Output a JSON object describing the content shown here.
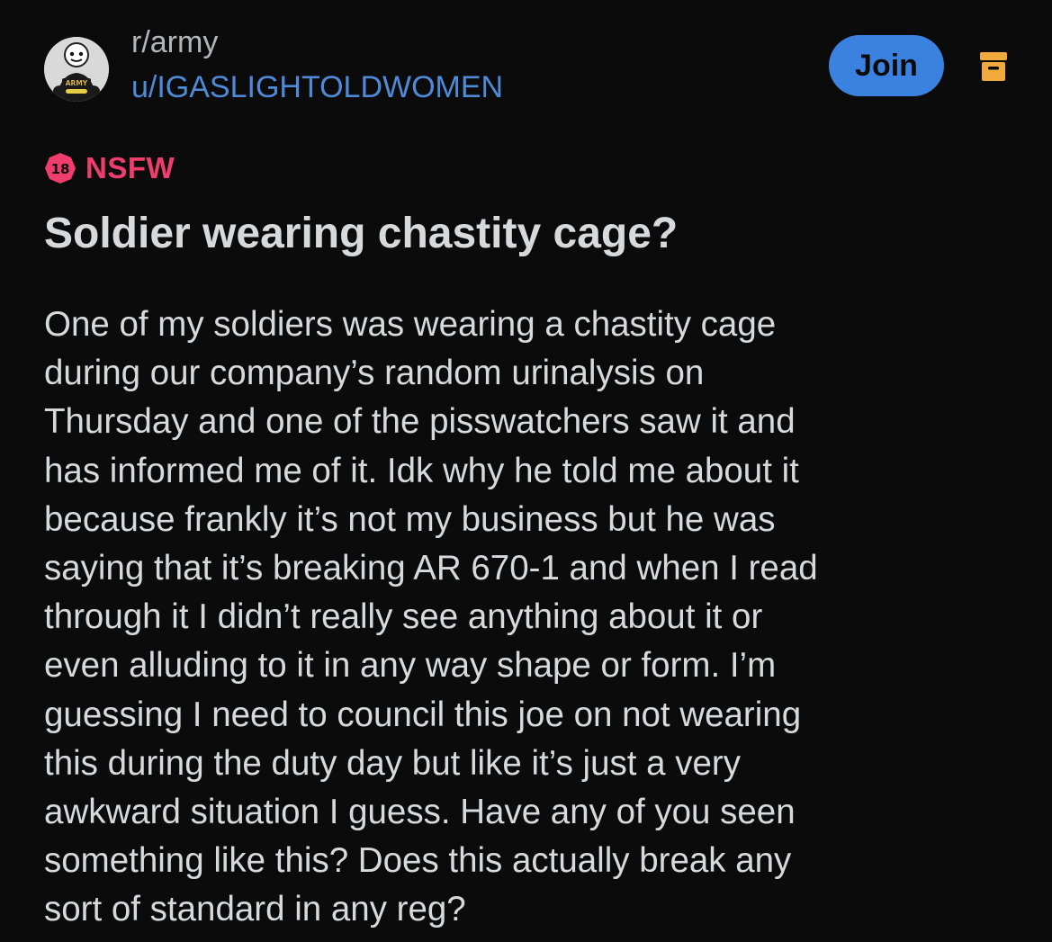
{
  "post": {
    "community": "r/army",
    "author": "u/IGASLIGHTOLDWOMEN",
    "join_label": "Join",
    "nsfw_label": "NSFW",
    "age_badge": "18",
    "avatar_text": "ARMY",
    "title": "Soldier wearing chastity cage?",
    "body_lines": [
      "One of my soldiers was wearing a chastity cage",
      "during our company’s random urinalysis on",
      "Thursday and one of the pisswatchers saw it and",
      "has informed me of it. Idk why he told me about it",
      "because frankly it’s not my business but he was",
      "saying that it’s breaking AR 670-1 and when I read",
      "through it I didn’t really see anything about it or",
      "even alluding to it in any way shape or form. I’m",
      "guessing I need to council this joe on not wearing",
      "this during the duty day but like it’s just a very",
      "awkward situation I guess. Have any of you seen",
      "something like this? Does this actually break any",
      "sort of standard in any reg?"
    ]
  },
  "icons": {
    "avatar": "community-avatar-icon",
    "menu": "archive-box-icon",
    "age": "age-18-badge-icon"
  },
  "colors": {
    "background": "#0b0b0c",
    "text": "#d7dadc",
    "community": "#b3b6b8",
    "username": "#4f8ad8",
    "join_button": "#3b82e0",
    "nsfw": "#ef3d6d",
    "menu_icon": "#f2a93b"
  }
}
